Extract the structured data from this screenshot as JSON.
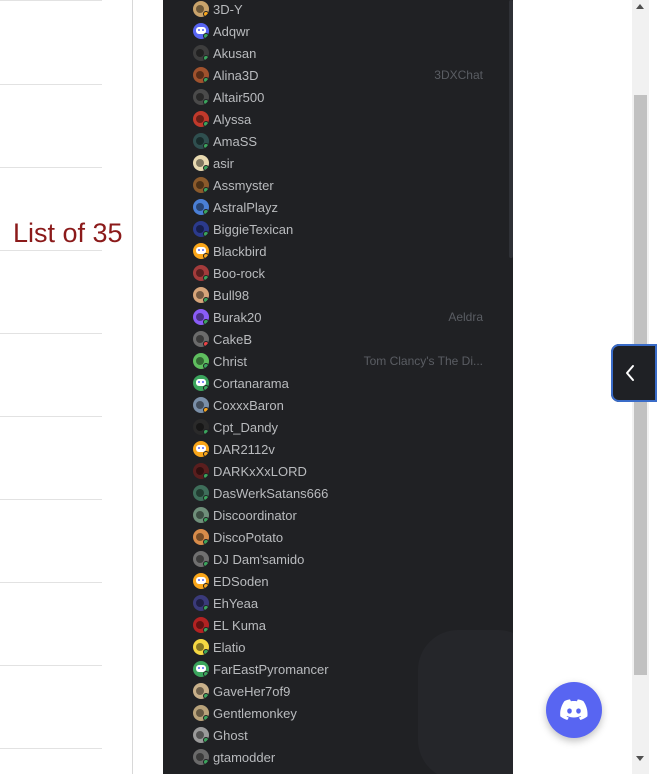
{
  "side_label": "List of 35",
  "members": [
    {
      "name": "3D-Y",
      "color": "#c9a36b",
      "status": "#faa61a",
      "game": ""
    },
    {
      "name": "Adqwr",
      "color": "#5865f2",
      "status": "#3ba55d",
      "game": "",
      "discord": true
    },
    {
      "name": "Akusan",
      "color": "#3d3d3d",
      "status": "#3ba55d",
      "game": ""
    },
    {
      "name": "Alina3D",
      "color": "#a0522d",
      "status": "#3ba55d",
      "game": "3DXChat"
    },
    {
      "name": "Altair500",
      "color": "#4a4a4a",
      "status": "#3ba55d",
      "game": ""
    },
    {
      "name": "Alyssa",
      "color": "#c0392b",
      "status": "#3ba55d",
      "game": ""
    },
    {
      "name": "AmaSS",
      "color": "#2f4f4f",
      "status": "#3ba55d",
      "game": ""
    },
    {
      "name": "asir",
      "color": "#e8d9b0",
      "status": "#3ba55d",
      "game": ""
    },
    {
      "name": "Assmyster",
      "color": "#8b5a2b",
      "status": "#3ba55d",
      "game": ""
    },
    {
      "name": "AstralPlayz",
      "color": "#4a7fd6",
      "status": "#3ba55d",
      "game": ""
    },
    {
      "name": "BiggieTexican",
      "color": "#2b3a8c",
      "status": "#3ba55d",
      "game": ""
    },
    {
      "name": "Blackbird",
      "color": "#faa61a",
      "status": "#faa61a",
      "game": "",
      "discord": true
    },
    {
      "name": "Boo-rock",
      "color": "#a33b3b",
      "status": "#3ba55d",
      "game": ""
    },
    {
      "name": "Bull98",
      "color": "#d6a57a",
      "status": "#3ba55d",
      "game": ""
    },
    {
      "name": "Burak20",
      "color": "#8a5cf6",
      "status": "#3ba55d",
      "game": "Aeldra"
    },
    {
      "name": "CakeB",
      "color": "#6b6b6b",
      "status": "#ed4245",
      "game": ""
    },
    {
      "name": "Christ",
      "color": "#5fbf5f",
      "status": "#3ba55d",
      "game": "Tom Clancy's The Di..."
    },
    {
      "name": "Cortanarama",
      "color": "#3ba55d",
      "status": "#3ba55d",
      "game": "",
      "discord": true
    },
    {
      "name": "CoxxxBaron",
      "color": "#7a8fa8",
      "status": "#faa61a",
      "game": ""
    },
    {
      "name": "Cpt_Dandy",
      "color": "#2a2a2a",
      "status": "#3ba55d",
      "game": ""
    },
    {
      "name": "DAR2112v",
      "color": "#faa61a",
      "status": "#faa61a",
      "game": "",
      "discord": true
    },
    {
      "name": "DARKxXxLORD",
      "color": "#5a1e1e",
      "status": "#3ba55d",
      "game": ""
    },
    {
      "name": "DasWerkSatans666",
      "color": "#3e6e5a",
      "status": "#3ba55d",
      "game": ""
    },
    {
      "name": "Discoordinator",
      "color": "#6f8f7a",
      "status": "#3ba55d",
      "game": ""
    },
    {
      "name": "DiscoPotato",
      "color": "#d98c4a",
      "status": "#3ba55d",
      "game": ""
    },
    {
      "name": "DJ Dam'samido",
      "color": "#707070",
      "status": "#3ba55d",
      "game": ""
    },
    {
      "name": "EDSoden",
      "color": "#faa61a",
      "status": "#faa61a",
      "game": "",
      "discord": true
    },
    {
      "name": "EhYeaa",
      "color": "#3a3a7a",
      "status": "#3ba55d",
      "game": ""
    },
    {
      "name": "EL Kuma",
      "color": "#b22222",
      "status": "#3ba55d",
      "game": ""
    },
    {
      "name": "Elatio",
      "color": "#f5d742",
      "status": "#3ba55d",
      "game": ""
    },
    {
      "name": "FarEastPyromancer",
      "color": "#3ba55d",
      "status": "#3ba55d",
      "game": "",
      "discord": true
    },
    {
      "name": "GaveHer7of9",
      "color": "#c8b08a",
      "status": "#3ba55d",
      "game": ""
    },
    {
      "name": "Gentlemonkey",
      "color": "#b8a27a",
      "status": "#3ba55d",
      "game": ""
    },
    {
      "name": "Ghost",
      "color": "#9a9a9a",
      "status": "#3ba55d",
      "game": ""
    },
    {
      "name": "gtamodder",
      "color": "#6a6a6a",
      "status": "#3ba55d",
      "game": ""
    }
  ],
  "icons": {
    "collapse": "chevron-left-icon",
    "fab": "discord-logo-icon"
  }
}
